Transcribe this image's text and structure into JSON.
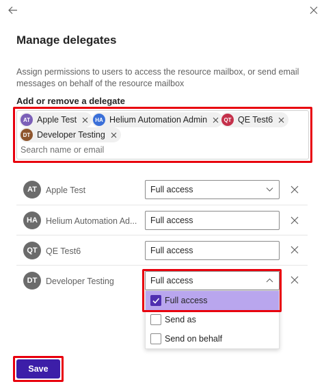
{
  "header": {
    "back_icon": "arrow-left-icon",
    "close_icon": "close-icon"
  },
  "title": "Manage delegates",
  "description": "Assign permissions to users to access the resource mailbox, or send email messages on behalf of the resource mailbox",
  "picker": {
    "label": "Add or remove a delegate",
    "placeholder": "Search name or email",
    "chips": [
      {
        "initials": "AT",
        "name": "Apple Test",
        "color": "#7b5fb8"
      },
      {
        "initials": "HA",
        "name": "Helium Automation Admin",
        "color": "#3a6fd8"
      },
      {
        "initials": "QT",
        "name": "QE Test6",
        "color": "#c4314b"
      },
      {
        "initials": "DT",
        "name": "Developer Testing",
        "color": "#8e562e"
      }
    ]
  },
  "delegates": [
    {
      "initials": "AT",
      "name": "Apple Test",
      "permission": "Full access"
    },
    {
      "initials": "HA",
      "name": "Helium Automation Ad...",
      "permission": "Full access"
    },
    {
      "initials": "QT",
      "name": "QE Test6",
      "permission": "Full access"
    },
    {
      "initials": "DT",
      "name": "Developer Testing",
      "permission": "Full access"
    }
  ],
  "permission_options": [
    {
      "label": "Full access",
      "checked": true
    },
    {
      "label": "Send as",
      "checked": false
    },
    {
      "label": "Send on behalf",
      "checked": false
    }
  ],
  "save_label": "Save",
  "colors": {
    "accent": "#3c1ea8",
    "highlight": "#e8000d",
    "option_selected": "#b9a6ee"
  }
}
